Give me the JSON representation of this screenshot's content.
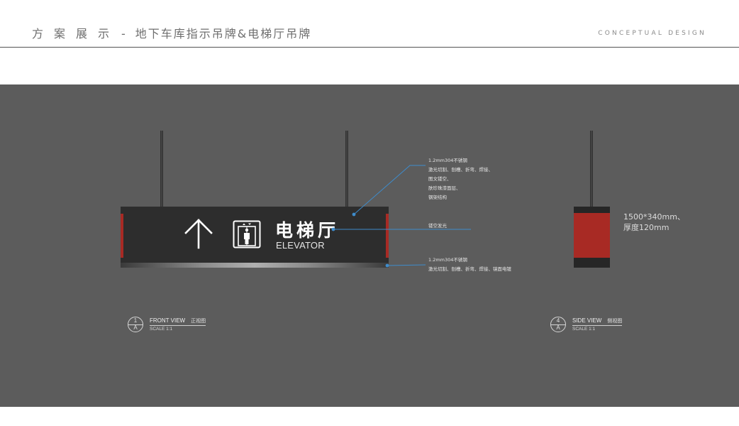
{
  "header": {
    "title_main": "方案展示",
    "title_separator": "-",
    "title_rest": "地下车库指示吊牌&电梯厅吊牌",
    "subtitle": "CONCEPTUAL DESIGN"
  },
  "sign": {
    "cn_text": "电梯厅",
    "en_text": "ELEVATOR",
    "arrow_icon": "up-arrow-icon",
    "elevator_icon": "elevator-person-icon",
    "colors": {
      "panel": "#2d2d2d",
      "accent_red": "#a82a24",
      "background": "#5c5c5c"
    }
  },
  "annotations": {
    "material_top": [
      "1.2mm304不锈钢",
      "激光切割、刨槽、折弯、焊接、",
      "图文镂空、",
      "肤珍珠漆面层、",
      "钢架结构"
    ],
    "light": "镂空发光",
    "material_bottom": [
      "1.2mm304不锈钢",
      "激光切割、刨槽、折弯、焊接、镜面电镀"
    ],
    "dimension": [
      "1500*340mm、",
      "厚度120mm"
    ]
  },
  "views": {
    "front": {
      "num": "1",
      "letter": "A",
      "name": "FRONT VIEW",
      "name_cn": "正视图",
      "scale": "SCALE 1:1"
    },
    "side": {
      "num": "4",
      "letter": "A",
      "name": "SIDE VIEW",
      "name_cn": "侧视图",
      "scale": "SCALE 1:1"
    }
  }
}
